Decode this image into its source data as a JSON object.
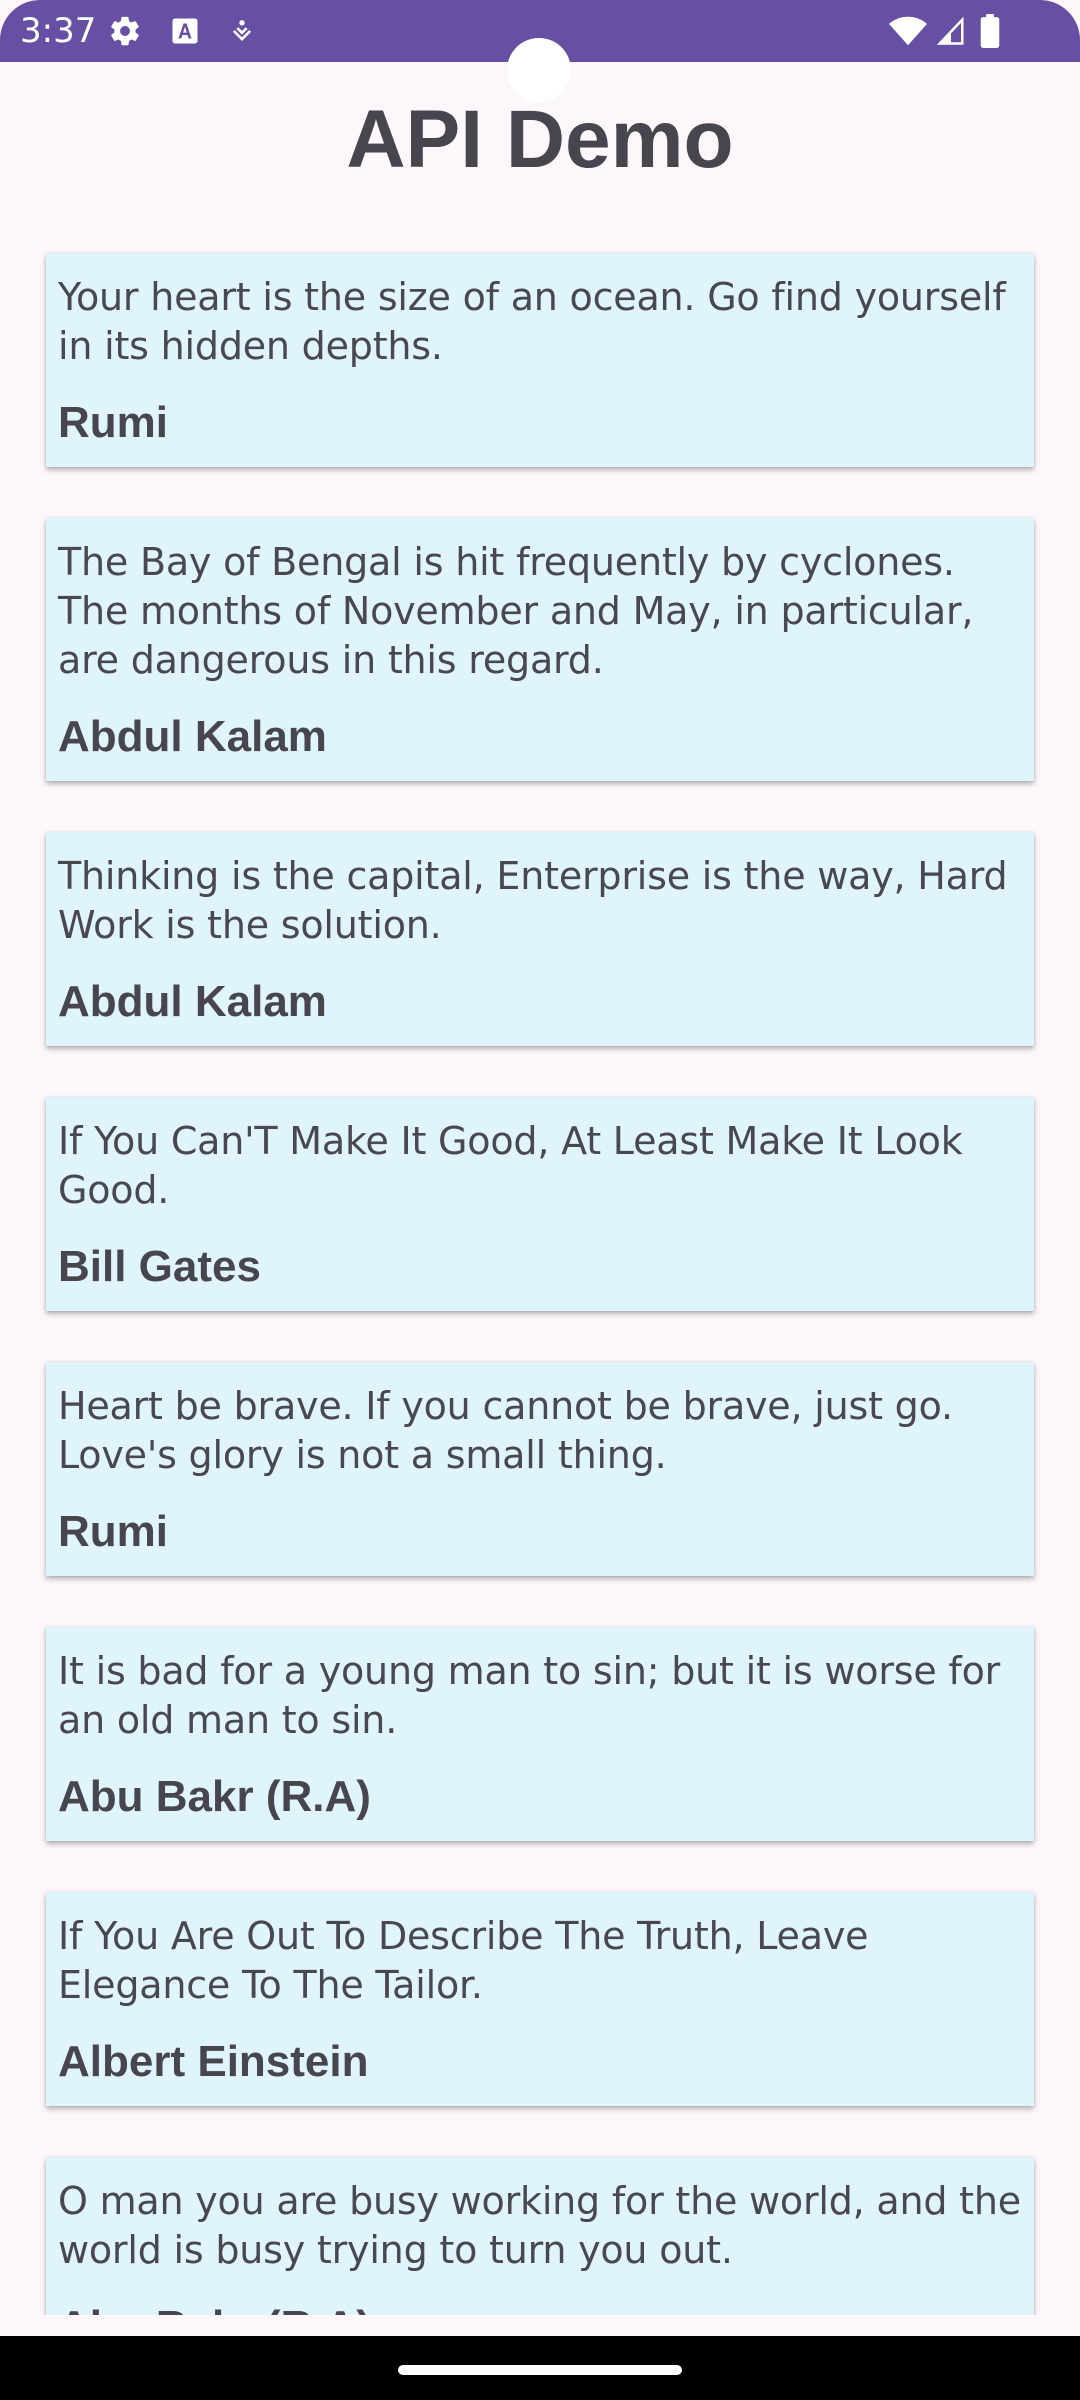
{
  "status_bar": {
    "time": "3:37",
    "background_color": "#6750a4",
    "left_icons": [
      "gear-icon",
      "font-a-icon",
      "notification-dot-icon"
    ],
    "right_icons": [
      "wifi-icon",
      "signal-icon",
      "battery-icon"
    ]
  },
  "header": {
    "title": "API Demo"
  },
  "quotes": [
    {
      "text": "Your heart is the size of an ocean. Go find yourself in its hidden depths.",
      "author": "Rumi"
    },
    {
      "text": "The Bay of Bengal is hit frequently by cyclones. The months of November and May, in particular, are dangerous in this regard.",
      "author": "Abdul Kalam"
    },
    {
      "text": "Thinking is the capital, Enterprise is the way, Hard Work is the solution.",
      "author": "Abdul Kalam"
    },
    {
      "text": "If You Can'T Make It Good, At Least Make It Look Good.",
      "author": "Bill Gates"
    },
    {
      "text": "Heart be brave. If you cannot be brave, just go. Love's glory is not a small thing.",
      "author": "Rumi"
    },
    {
      "text": "It is bad for a young man to sin; but it is worse for an old man to sin.",
      "author": "Abu Bakr (R.A)"
    },
    {
      "text": "If You Are Out To Describe The Truth, Leave Elegance To The Tailor.",
      "author": "Albert Einstein"
    },
    {
      "text": "O man you are busy working for the world, and the world is busy trying to turn you out.",
      "author": "Abu Bakr (R.A)"
    }
  ],
  "colors": {
    "card_background": "#e0f4fc",
    "page_background": "#fdf7fb",
    "text": "#49474f"
  }
}
